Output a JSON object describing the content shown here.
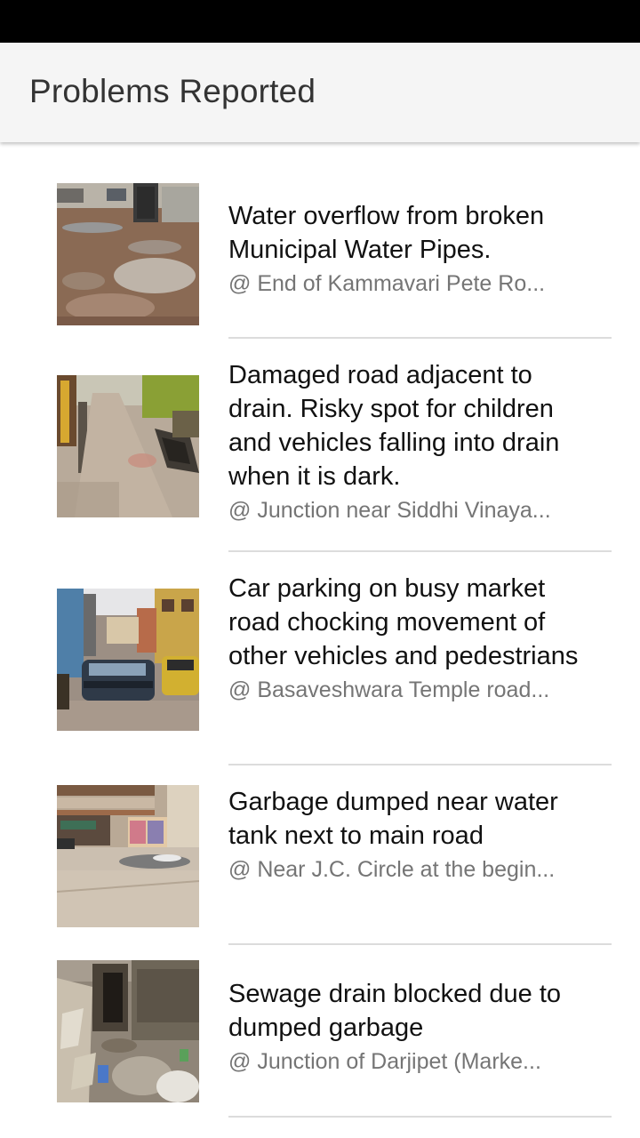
{
  "app_bar": {
    "title": "Problems Reported"
  },
  "problems": [
    {
      "title": "Water overflow from broken Municipal Water Pipes.",
      "location": "@ End of Kammavari Pete Ro...",
      "thumbnail": "photo-water-overflow"
    },
    {
      "title": "Damaged road adjacent to drain. Risky spot for children and vehicles falling into drain when it is dark.",
      "location": "@ Junction near Siddhi Vinaya...",
      "thumbnail": "photo-damaged-road"
    },
    {
      "title": "Car parking on busy market road chocking movement of other vehicles and pedestrians",
      "location": "@ Basaveshwara Temple road...",
      "thumbnail": "photo-car-parking"
    },
    {
      "title": "Garbage dumped near water tank next to main road",
      "location": "@ Near J.C. Circle at the begin...",
      "thumbnail": "photo-garbage-dump"
    },
    {
      "title": "Sewage drain blocked due to dumped garbage",
      "location": "@ Junction of Darjipet (Marke...",
      "thumbnail": "photo-sewage-drain"
    }
  ]
}
